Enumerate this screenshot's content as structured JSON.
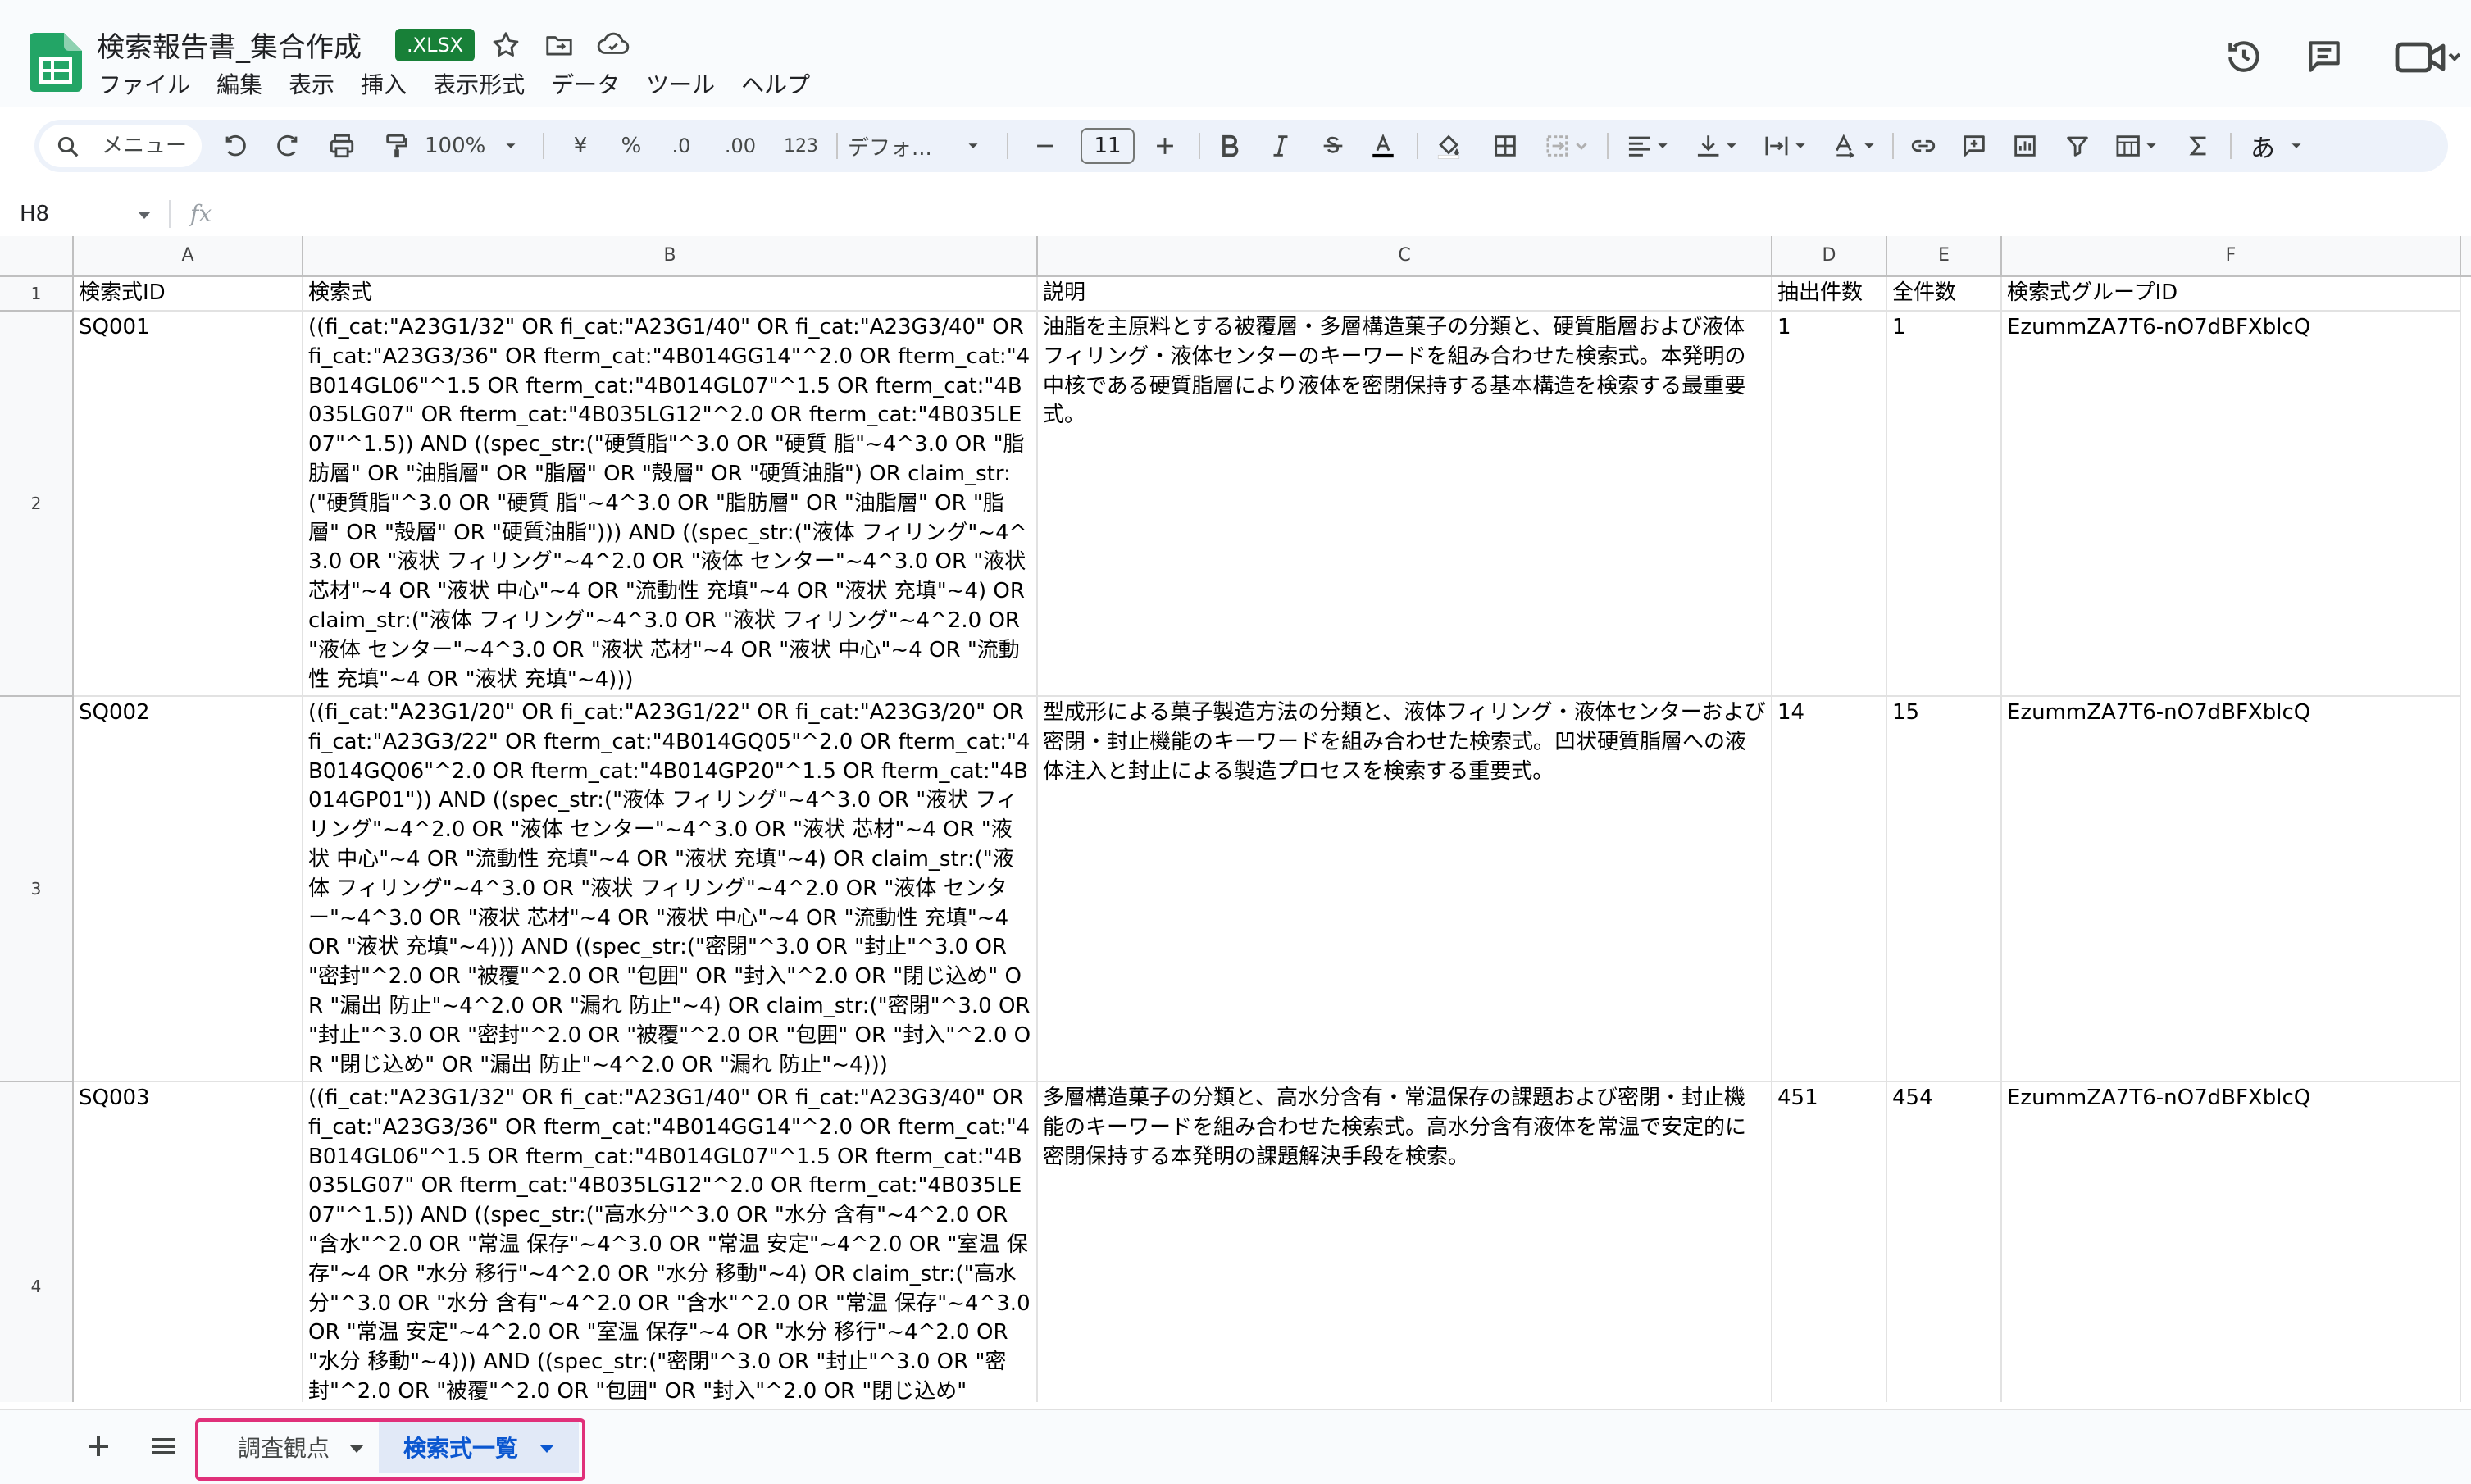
{
  "header": {
    "title": "検索報告書_集合作成",
    "badge": ".XLSX",
    "menus": [
      "ファイル",
      "編集",
      "表示",
      "挿入",
      "表示形式",
      "データ",
      "ツール",
      "ヘルプ"
    ]
  },
  "toolbar": {
    "search_menu": "メニュー",
    "zoom": "100%",
    "currency": "¥",
    "percent": "%",
    "dec_decrease": ".0",
    "dec_increase": ".00",
    "number_format": "123",
    "font": "デフォ...",
    "font_size": "11",
    "input_mode": "あ"
  },
  "formula_bar": {
    "cell_ref": "H8",
    "fx": "fx"
  },
  "grid": {
    "columns": [
      "A",
      "B",
      "C",
      "D",
      "E",
      "F"
    ],
    "row_numbers": [
      "1",
      "2",
      "3",
      "4"
    ],
    "header_row": [
      "検索式ID",
      "検索式",
      "説明",
      "抽出件数",
      "全件数",
      "検索式グループID"
    ],
    "rows": [
      {
        "id": "SQ001",
        "query": "((fi_cat:\"A23G1/32\" OR fi_cat:\"A23G1/40\" OR fi_cat:\"A23G3/40\" OR fi_cat:\"A23G3/36\" OR fterm_cat:\"4B014GG14\"^2.0 OR fterm_cat:\"4B014GL06\"^1.5 OR fterm_cat:\"4B014GL07\"^1.5 OR fterm_cat:\"4B035LG07\" OR fterm_cat:\"4B035LG12\"^2.0 OR fterm_cat:\"4B035LE07\"^1.5)) AND ((spec_str:(\"硬質脂\"^3.0 OR \"硬質 脂\"~4^3.0 OR \"脂肪層\" OR \"油脂層\" OR \"脂層\" OR \"殻層\" OR \"硬質油脂\") OR claim_str:(\"硬質脂\"^3.0 OR \"硬質 脂\"~4^3.0 OR \"脂肪層\" OR \"油脂層\" OR \"脂層\" OR \"殻層\" OR \"硬質油脂\"))) AND ((spec_str:(\"液体 フィリング\"~4^3.0 OR \"液状 フィリング\"~4^2.0 OR \"液体 センター\"~4^3.0 OR \"液状 芯材\"~4 OR \"液状 中心\"~4 OR \"流動性 充填\"~4 OR \"液状 充填\"~4) OR claim_str:(\"液体 フィリング\"~4^3.0 OR \"液状 フィリング\"~4^2.0 OR \"液体 センター\"~4^3.0 OR \"液状 芯材\"~4 OR \"液状 中心\"~4 OR \"流動性 充填\"~4 OR \"液状 充填\"~4)))",
        "desc": "油脂を主原料とする被覆層・多層構造菓子の分類と、硬質脂層および液体フィリング・液体センターのキーワードを組み合わせた検索式。本発明の中核である硬質脂層により液体を密閉保持する基本構造を検索する最重要式。",
        "extracted": "1",
        "total": "1",
        "group": "EzummZA7T6-nO7dBFXblcQ"
      },
      {
        "id": "SQ002",
        "query": "((fi_cat:\"A23G1/20\" OR fi_cat:\"A23G1/22\" OR fi_cat:\"A23G3/20\" OR fi_cat:\"A23G3/22\" OR fterm_cat:\"4B014GQ05\"^2.0 OR fterm_cat:\"4B014GQ06\"^2.0 OR fterm_cat:\"4B014GP20\"^1.5 OR fterm_cat:\"4B014GP01\")) AND ((spec_str:(\"液体 フィリング\"~4^3.0 OR \"液状 フィリング\"~4^2.0 OR \"液体 センター\"~4^3.0 OR \"液状 芯材\"~4 OR \"液状 中心\"~4 OR \"流動性 充填\"~4 OR \"液状 充填\"~4) OR claim_str:(\"液体 フィリング\"~4^3.0 OR \"液状 フィリング\"~4^2.0 OR \"液体 センター\"~4^3.0 OR \"液状 芯材\"~4 OR \"液状 中心\"~4 OR \"流動性 充填\"~4 OR \"液状 充填\"~4))) AND ((spec_str:(\"密閉\"^3.0 OR \"封止\"^3.0 OR \"密封\"^2.0 OR \"被覆\"^2.0 OR \"包囲\" OR \"封入\"^2.0 OR \"閉じ込め\" OR \"漏出 防止\"~4^2.0 OR \"漏れ 防止\"~4) OR claim_str:(\"密閉\"^3.0 OR \"封止\"^3.0 OR \"密封\"^2.0 OR \"被覆\"^2.0 OR \"包囲\" OR \"封入\"^2.0 OR \"閉じ込め\" OR \"漏出 防止\"~4^2.0 OR \"漏れ 防止\"~4)))",
        "desc": "型成形による菓子製造方法の分類と、液体フィリング・液体センターおよび密閉・封止機能のキーワードを組み合わせた検索式。凹状硬質脂層への液体注入と封止による製造プロセスを検索する重要式。",
        "extracted": "14",
        "total": "15",
        "group": "EzummZA7T6-nO7dBFXblcQ"
      },
      {
        "id": "SQ003",
        "query": "((fi_cat:\"A23G1/32\" OR fi_cat:\"A23G1/40\" OR fi_cat:\"A23G3/40\" OR fi_cat:\"A23G3/36\" OR fterm_cat:\"4B014GG14\"^2.0 OR fterm_cat:\"4B014GL06\"^1.5 OR fterm_cat:\"4B014GL07\"^1.5 OR fterm_cat:\"4B035LG07\" OR fterm_cat:\"4B035LG12\"^2.0 OR fterm_cat:\"4B035LE07\"^1.5)) AND ((spec_str:(\"高水分\"^3.0 OR \"水分 含有\"~4^2.0 OR \"含水\"^2.0 OR \"常温 保存\"~4^3.0 OR \"常温 安定\"~4^2.0 OR \"室温 保存\"~4 OR \"水分 移行\"~4^2.0 OR \"水分 移動\"~4) OR claim_str:(\"高水分\"^3.0 OR \"水分 含有\"~4^2.0 OR \"含水\"^2.0 OR \"常温 保存\"~4^3.0 OR \"常温 安定\"~4^2.0 OR \"室温 保存\"~4 OR \"水分 移行\"~4^2.0 OR \"水分 移動\"~4))) AND ((spec_str:(\"密閉\"^3.0 OR \"封止\"^3.0 OR \"密封\"^2.0 OR \"被覆\"^2.0 OR \"包囲\" OR \"封入\"^2.0 OR \"閉じ込め\"",
        "desc": "多層構造菓子の分類と、高水分含有・常温保存の課題および密閉・封止機能のキーワードを組み合わせた検索式。高水分含有液体を常温で安定的に密閉保持する本発明の課題解決手段を検索。",
        "extracted": "451",
        "total": "454",
        "group": "EzummZA7T6-nO7dBFXblcQ"
      }
    ]
  },
  "sheet_tabs": [
    {
      "label": "調査観点"
    },
    {
      "label": "検索式一覧",
      "active": true
    }
  ],
  "colors": {
    "accent": "#0b57d0",
    "sheets_green": "#188038",
    "tab_highlight": "#e0307a"
  }
}
